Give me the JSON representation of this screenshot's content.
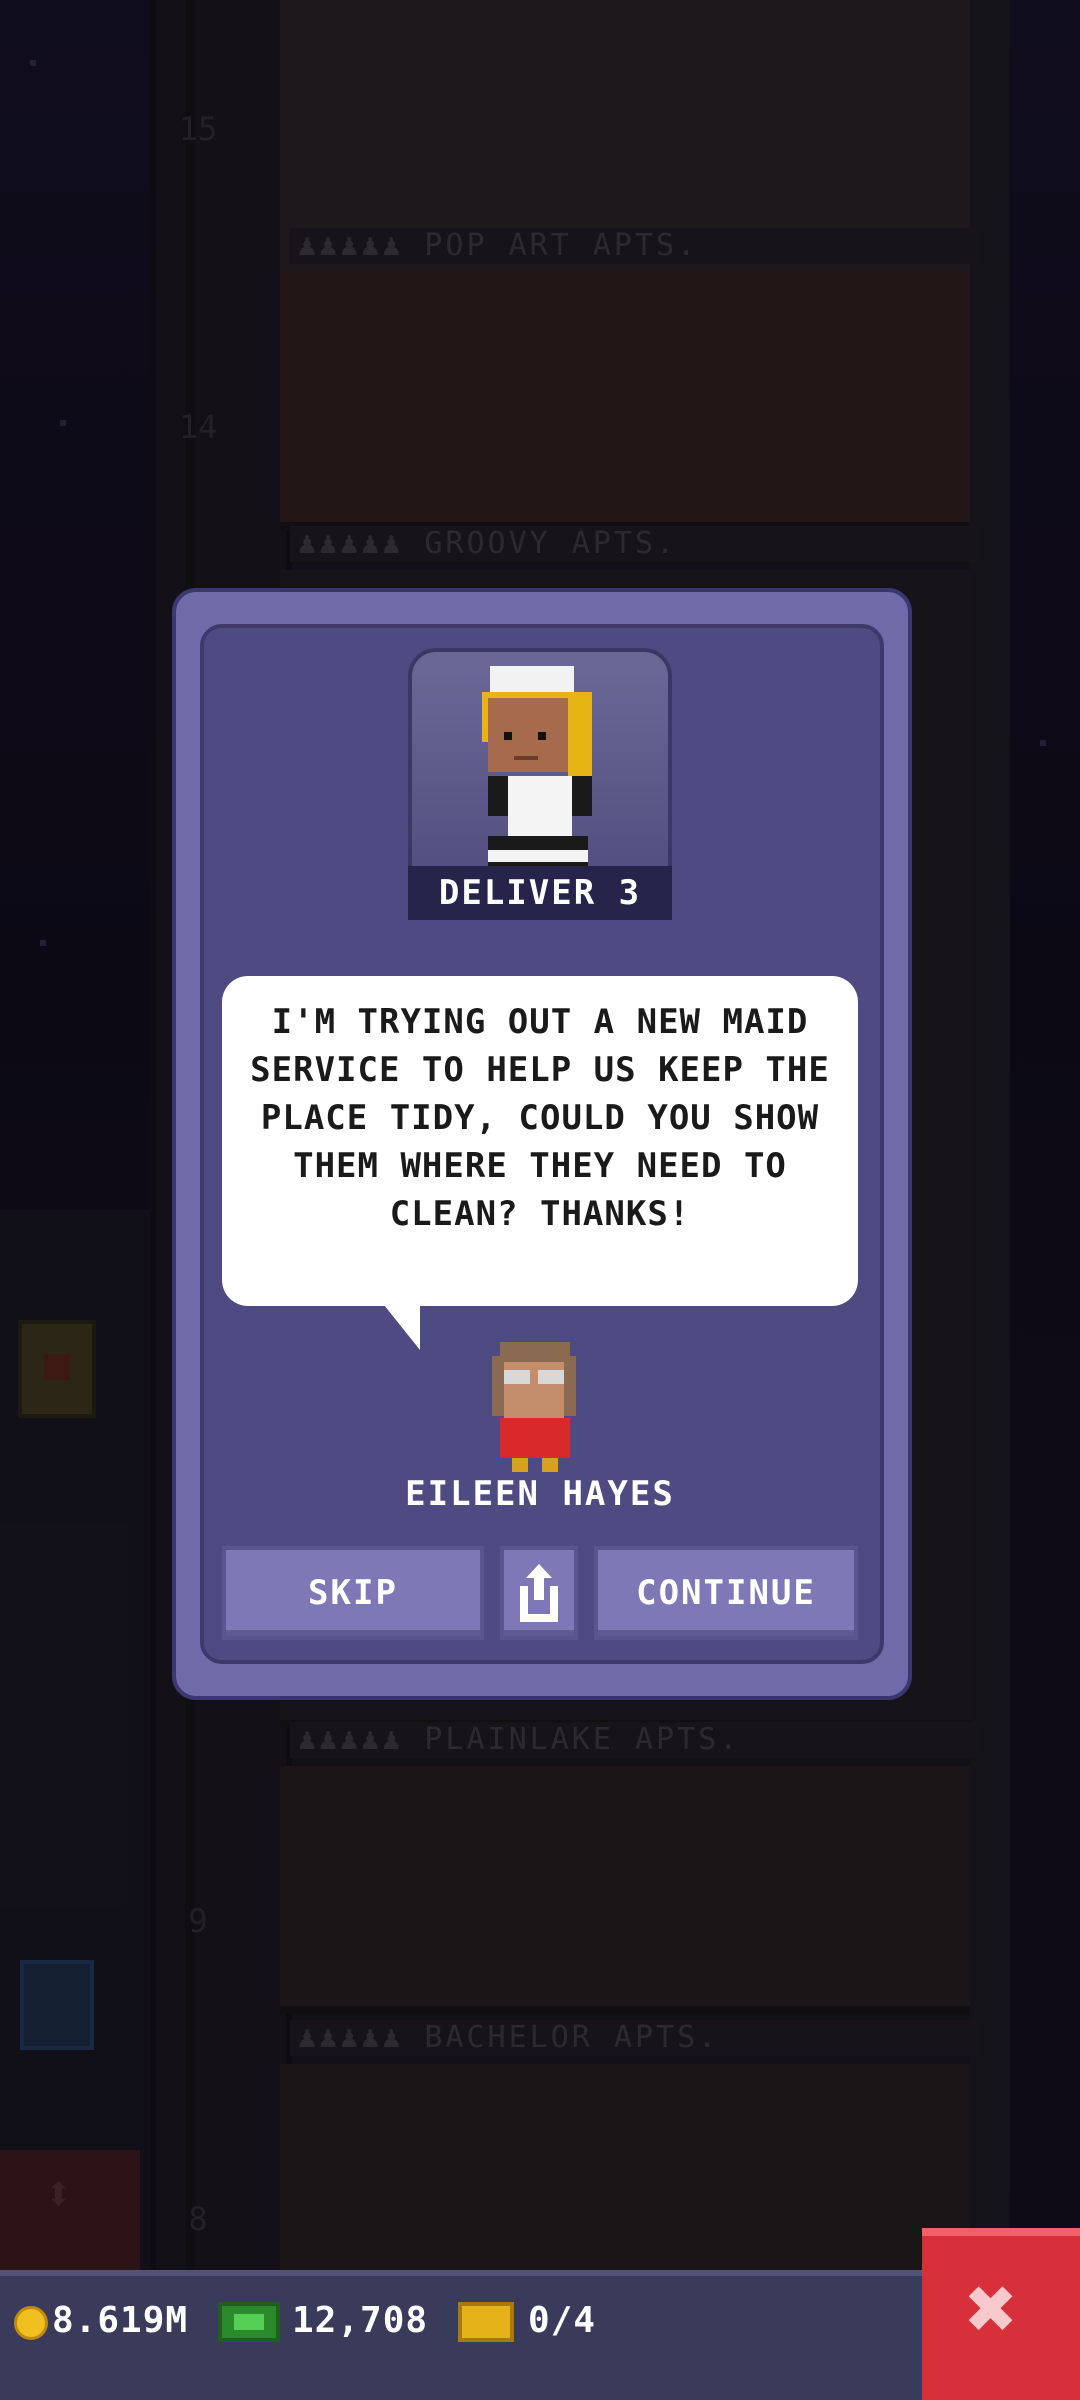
{
  "floors": [
    {
      "number": "15",
      "label": "♟♟♟♟♟  POP ART APTS."
    },
    {
      "number": "14",
      "label": "♟♟♟♟♟  GROOVY APTS."
    },
    {
      "number": "",
      "label": "♟♟♟♟♟  PLAINLAKE APTS."
    },
    {
      "number": "9",
      "label": "♟♟♟♟♟  BACHELOR APTS."
    },
    {
      "number": "8",
      "label": ""
    }
  ],
  "mission": {
    "goal": "DELIVER 3",
    "message": "I'M TRYING OUT A NEW MAID SERVICE TO HELP US KEEP THE PLACE TIDY, COULD YOU SHOW THEM WHERE THEY NEED TO CLEAN? THANKS!",
    "speaker": "EILEEN HAYES"
  },
  "buttons": {
    "skip": "SKIP",
    "continue": "CONTINUE"
  },
  "status_bar": {
    "coins": "8.619M",
    "bux": "12,708",
    "tickets": "0/4"
  },
  "icons": {
    "share": "share-icon",
    "close": "close-icon",
    "coin": "coin-icon",
    "bux": "bux-icon",
    "ticket": "ticket-icon"
  },
  "colors": {
    "dialog": "#4e4a82",
    "close_button": "#d7303a"
  }
}
